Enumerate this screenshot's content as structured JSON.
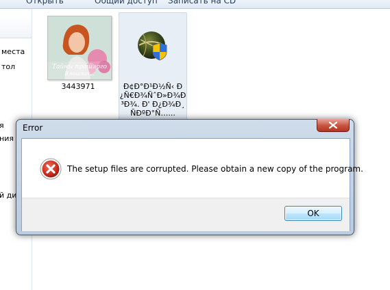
{
  "toolbar": {
    "items": [
      "Открыть",
      "Общий доступ",
      "Записать на CD"
    ]
  },
  "nav": {
    "items": [
      "места",
      "тол",
      "я",
      "ния",
      "й дис"
    ]
  },
  "files": [
    {
      "label": "3443971",
      "thumb_caption": "Тайны прошлого",
      "thumb_subcaption": "В поисках..."
    },
    {
      "label": "Ð¢Ð°Ð¹Ð½Ñ‹ Ð¿Ñ€Ð¾ÑˆÐ»Ð¾Ð³Ð¾. Ð' Ð¿Ð¾Ð¸ÑÐºÐ°Ñ…..."
    }
  ],
  "dialog": {
    "title": "Error",
    "message": "The setup files are corrupted. Please obtain a new copy of the program.",
    "ok_label": "OK"
  },
  "colors": {
    "error_red": "#c42b1c",
    "close_red": "#c5533f",
    "ok_border": "#3c7fb1"
  }
}
